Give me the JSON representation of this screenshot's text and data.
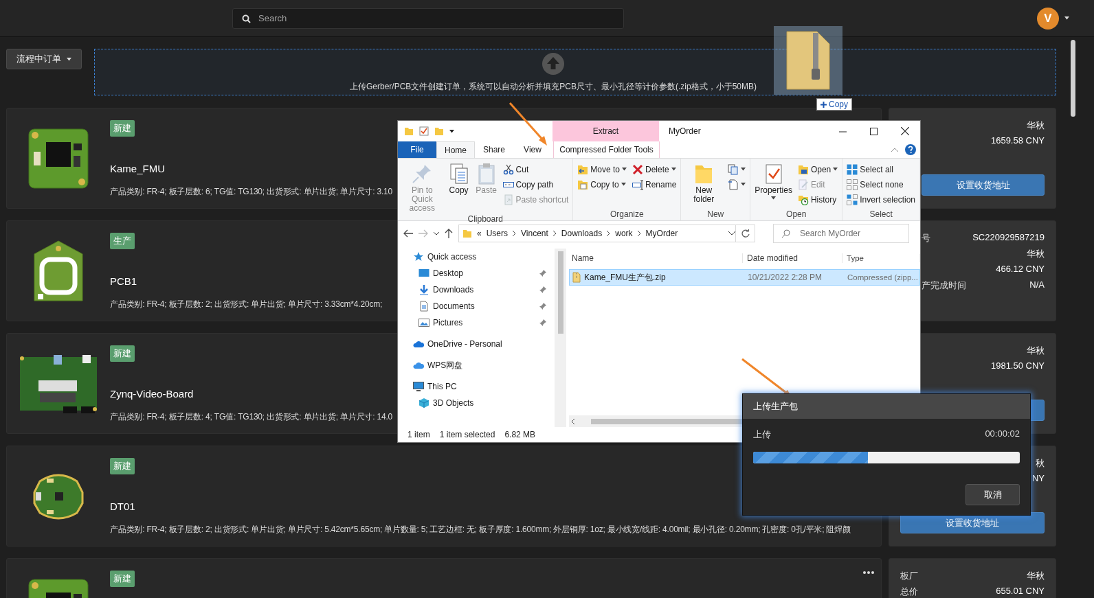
{
  "header": {
    "search": {
      "placeholder": "Search"
    },
    "avatar": {
      "initial": "V"
    }
  },
  "filter": {
    "label": "流程中订单"
  },
  "upload": {
    "text": "上传Gerber/PCB文件创建订单，系统可以自动分析并填充PCB尺寸、最小孔径等计价参数(.zip格式，小于50MB)"
  },
  "drag": {
    "label": "Copy"
  },
  "orders": [
    {
      "status": "新建",
      "kind": "square",
      "name": "Kame_FMU",
      "specs": "产品类别: FR-4; 板子层数: 6; TG值: TG130; 出货形式: 单片出货; 单片尺寸: 3.10",
      "more": false,
      "details": [
        {
          "kind": "pair",
          "value": "华秋"
        },
        {
          "kind": "pair",
          "value": "1659.58 CNY"
        },
        {
          "kind": "button",
          "label": "设置收货地址"
        }
      ]
    },
    {
      "status": "生产",
      "kind": "tag",
      "name": "PCB1",
      "specs": "产品类别: FR-4; 板子层数: 2; 出货形式: 单片出货; 单片尺寸: 3.33cm*4.20cm;",
      "more": false,
      "details": [
        {
          "kind": "pair",
          "label": "号",
          "value": "SC220929587219"
        },
        {
          "kind": "pair",
          "value": "华秋"
        },
        {
          "kind": "pair",
          "value": "466.12 CNY"
        },
        {
          "kind": "pair",
          "label": "产完成时间",
          "value": "N/A"
        }
      ]
    },
    {
      "status": "新建",
      "kind": "rect",
      "name": "Zynq-Video-Board",
      "specs": "产品类别: FR-4; 板子层数: 4; TG值: TG130; 出货形式: 单片出货; 单片尺寸: 14.0",
      "more": false,
      "details": [
        {
          "kind": "pair",
          "value": "华秋"
        },
        {
          "kind": "pair",
          "value": "1981.50 CNY"
        },
        {
          "kind": "button"
        }
      ]
    },
    {
      "status": "新建",
      "kind": "round",
      "name": "DT01",
      "specs": "产品类别: FR-4; 板子层数: 2; 出货形式: 单片出货; 单片尺寸: 5.42cm*5.65cm; 单片数量: 5; 工艺边框: 无; 板子厚度: 1.600mm; 外层铜厚: 1oz; 最小线宽/线距: 4.00mil; 最小孔径: 0.20mm; 孔密度: 0孔/平米; 阻焊颜",
      "more": false,
      "details": [
        {
          "kind": "pair",
          "value": "秋"
        },
        {
          "kind": "pair",
          "value": "NY"
        },
        {
          "kind": "button",
          "label": "设置收货地址"
        }
      ]
    },
    {
      "status": "新建",
      "kind": "square",
      "more": true,
      "details": [
        {
          "kind": "pair",
          "label": "板厂",
          "value": "华秋"
        },
        {
          "kind": "pair",
          "label": "总价",
          "value": "655.01 CNY"
        }
      ]
    }
  ],
  "explorer": {
    "title": "MyOrder",
    "context_header": "Extract",
    "tabs": [
      {
        "label": "File",
        "kind": "file",
        "selected": false
      },
      {
        "label": "Home",
        "kind": "tab",
        "selected": true
      },
      {
        "label": "Share",
        "kind": "tab",
        "selected": false
      },
      {
        "label": "View",
        "kind": "tab",
        "selected": false
      },
      {
        "label": "Compressed Folder Tools",
        "kind": "context",
        "selected": false
      }
    ],
    "ribbon": [
      {
        "name": "Clipboard",
        "items": [
          {
            "kind": "large",
            "label": "Pin to Quick access",
            "disabled": true,
            "dropdown": false
          },
          {
            "kind": "large",
            "label": "Copy",
            "disabled": false,
            "dropdown": false
          },
          {
            "kind": "large",
            "label": "Paste",
            "disabled": true,
            "dropdown": false
          },
          {
            "kind": "stack",
            "items": [
              {
                "label": "Cut",
                "disabled": false,
                "dropdown": false
              },
              {
                "label": "Copy path",
                "disabled": false,
                "dropdown": false
              },
              {
                "label": "Paste shortcut",
                "disabled": true,
                "dropdown": false
              }
            ]
          }
        ]
      },
      {
        "name": "Organize",
        "items": [
          {
            "kind": "stack",
            "items": [
              {
                "label": "Move to",
                "disabled": false,
                "dropdown": true
              },
              {
                "label": "Copy to",
                "disabled": false,
                "dropdown": true
              }
            ]
          },
          {
            "kind": "stack",
            "items": [
              {
                "label": "Delete",
                "disabled": false,
                "dropdown": true
              },
              {
                "label": "Rename",
                "disabled": false,
                "dropdown": false
              }
            ]
          }
        ]
      },
      {
        "name": "New",
        "items": [
          {
            "kind": "large",
            "label": "New folder",
            "disabled": false,
            "dropdown": false
          },
          {
            "kind": "stack",
            "items": [
              {
                "disabled": false,
                "dropdown": true
              },
              {
                "disabled": false,
                "dropdown": true
              }
            ]
          }
        ]
      },
      {
        "name": "Open",
        "items": [
          {
            "kind": "large",
            "label": "Properties",
            "disabled": false,
            "dropdown": true
          },
          {
            "kind": "stack",
            "items": [
              {
                "label": "Open",
                "disabled": false,
                "dropdown": true
              },
              {
                "label": "Edit",
                "disabled": true,
                "dropdown": false
              },
              {
                "label": "History",
                "disabled": false,
                "dropdown": false
              }
            ]
          }
        ]
      },
      {
        "name": "Select",
        "items": [
          {
            "kind": "stack",
            "items": [
              {
                "label": "Select all",
                "disabled": false,
                "dropdown": false
              },
              {
                "label": "Select none",
                "disabled": false,
                "dropdown": false
              },
              {
                "label": "Invert selection",
                "disabled": false,
                "dropdown": false
              }
            ]
          }
        ]
      }
    ],
    "address": {
      "overflow": "«",
      "path": [
        "Users",
        "Vincent",
        "Downloads",
        "work",
        "MyOrder"
      ],
      "search_placeholder": "Search MyOrder"
    },
    "nav": [
      {
        "label": "Quick access",
        "children": [
          {
            "label": "Desktop",
            "pinned": true
          },
          {
            "label": "Downloads",
            "pinned": true
          },
          {
            "label": "Documents",
            "pinned": true
          },
          {
            "label": "Pictures",
            "pinned": true
          }
        ]
      },
      {
        "label": "OneDrive - Personal"
      },
      {
        "label": "WPS网盘"
      },
      {
        "label": "This PC",
        "children": [
          {
            "label": "3D Objects"
          }
        ]
      }
    ],
    "columns": [
      "Name",
      "Date modified",
      "Type"
    ],
    "files": [
      {
        "name": "Kame_FMU生产包.zip",
        "date": "10/21/2022 2:28 PM",
        "type": "Compressed (zipp...",
        "selected": true
      }
    ],
    "status": {
      "count": "1 item",
      "selection": "1 item selected",
      "size": "6.82 MB"
    }
  },
  "dialog": {
    "title": "上传生产包",
    "label": "上传",
    "elapsed": "00:00:02",
    "level": 0.43,
    "cancel": "取消"
  }
}
